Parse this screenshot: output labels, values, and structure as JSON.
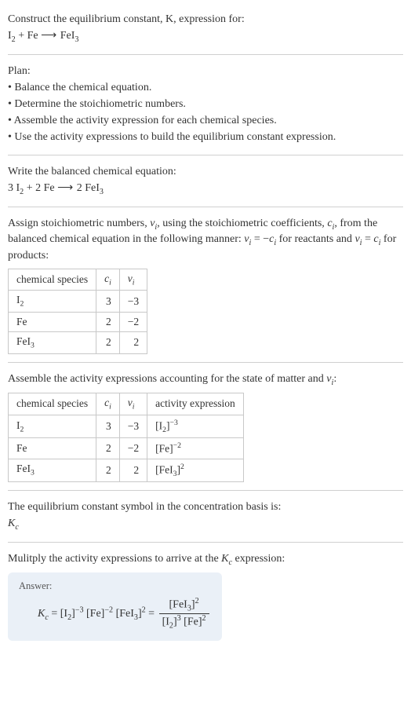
{
  "intro": {
    "prompt": "Construct the equilibrium constant, K, expression for:",
    "equation_html": "I<sub>2</sub> + Fe  <span class='arrow'>⟶</span>  FeI<sub>3</sub>"
  },
  "plan": {
    "heading": "Plan:",
    "items": [
      "• Balance the chemical equation.",
      "• Determine the stoichiometric numbers.",
      "• Assemble the activity expression for each chemical species.",
      "• Use the activity expressions to build the equilibrium constant expression."
    ]
  },
  "balanced": {
    "heading": "Write the balanced chemical equation:",
    "equation_html": "3 I<sub>2</sub> + 2 Fe  <span class='arrow'>⟶</span>  2 FeI<sub>3</sub>"
  },
  "assign": {
    "text_html": "Assign stoichiometric numbers, <span class='ital'>ν<sub>i</sub></span>, using the stoichiometric coefficients, <span class='ital'>c<sub>i</sub></span>, from the balanced chemical equation in the following manner: <span class='ital'>ν<sub>i</sub></span> = −<span class='ital'>c<sub>i</sub></span> for reactants and <span class='ital'>ν<sub>i</sub></span> = <span class='ital'>c<sub>i</sub></span> for products:",
    "headers": {
      "species": "chemical species",
      "ci_html": "<span class='ital'>c<sub>i</sub></span>",
      "vi_html": "<span class='ital'>ν<sub>i</sub></span>"
    },
    "rows": [
      {
        "species_html": "I<sub>2</sub>",
        "ci": "3",
        "vi": "−3"
      },
      {
        "species_html": "Fe",
        "ci": "2",
        "vi": "−2"
      },
      {
        "species_html": "FeI<sub>3</sub>",
        "ci": "2",
        "vi": "2"
      }
    ]
  },
  "activity": {
    "text_html": "Assemble the activity expressions accounting for the state of matter and <span class='ital'>ν<sub>i</sub></span>:",
    "headers": {
      "species": "chemical species",
      "ci_html": "<span class='ital'>c<sub>i</sub></span>",
      "vi_html": "<span class='ital'>ν<sub>i</sub></span>",
      "act": "activity expression"
    },
    "rows": [
      {
        "species_html": "I<sub>2</sub>",
        "ci": "3",
        "vi": "−3",
        "act_html": "[I<sub>2</sub>]<sup>−3</sup>"
      },
      {
        "species_html": "Fe",
        "ci": "2",
        "vi": "−2",
        "act_html": "[Fe]<sup>−2</sup>"
      },
      {
        "species_html": "FeI<sub>3</sub>",
        "ci": "2",
        "vi": "2",
        "act_html": "[FeI<sub>3</sub>]<sup>2</sup>"
      }
    ]
  },
  "symbol": {
    "text": "The equilibrium constant symbol in the concentration basis is:",
    "sym_html": "<span class='ital'>K<sub>c</sub></span>"
  },
  "multiply": {
    "text_html": "Mulitply the activity expressions to arrive at the <span class='ital'>K<sub>c</sub></span> expression:"
  },
  "answer": {
    "label": "Answer:",
    "lhs_html": "<span class='ital'>K<sub>c</sub></span> = [I<sub>2</sub>]<sup>−3</sup> [Fe]<sup>−2</sup> [FeI<sub>3</sub>]<sup>2</sup> = ",
    "frac_num_html": "[FeI<sub>3</sub>]<sup>2</sup>",
    "frac_den_html": "[I<sub>2</sub>]<sup>3</sup> [Fe]<sup>2</sup>"
  }
}
